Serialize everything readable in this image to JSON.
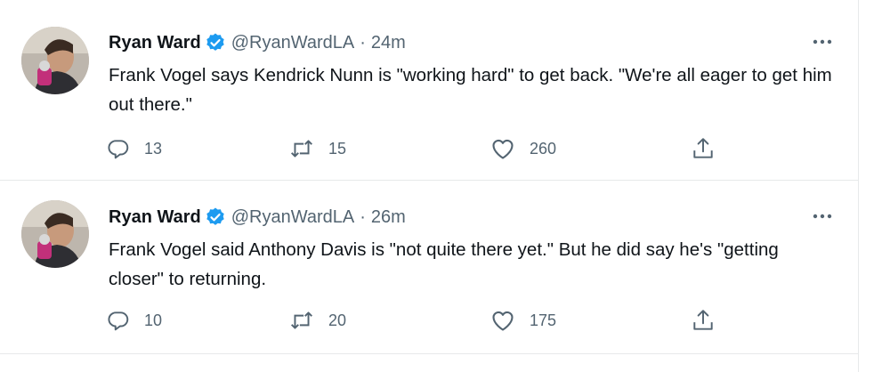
{
  "colors": {
    "verified_badge": "#1d9bf0",
    "secondary_text": "#536471",
    "primary_text": "#0f1419",
    "divider": "#e7e9ea"
  },
  "tweets": [
    {
      "author_name": "Ryan Ward",
      "handle": "@RyanWardLA",
      "separator": "·",
      "time": "24m",
      "text": "Frank Vogel says Kendrick Nunn is \"working hard\" to get back. \"We're all eager to get him out there.\"",
      "replies": "13",
      "retweets": "15",
      "likes": "260",
      "icons": {
        "reply": "reply-icon",
        "retweet": "retweet-icon",
        "like": "heart-icon",
        "share": "share-icon",
        "more": "more-icon",
        "verified": "verified-badge-icon"
      }
    },
    {
      "author_name": "Ryan Ward",
      "handle": "@RyanWardLA",
      "separator": "·",
      "time": "26m",
      "text": "Frank Vogel said Anthony Davis is \"not quite there yet.\" But he did say he's \"getting closer\" to returning.",
      "replies": "10",
      "retweets": "20",
      "likes": "175",
      "icons": {
        "reply": "reply-icon",
        "retweet": "retweet-icon",
        "like": "heart-icon",
        "share": "share-icon",
        "more": "more-icon",
        "verified": "verified-badge-icon"
      }
    }
  ]
}
